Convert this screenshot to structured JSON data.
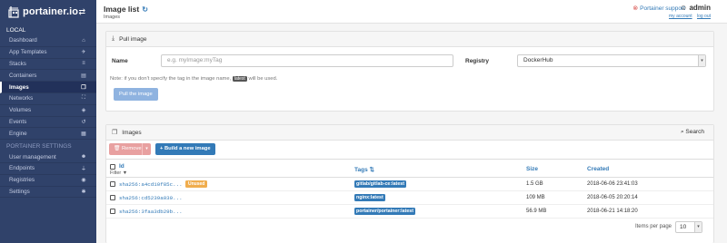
{
  "sidebar": {
    "brand": "portainer.io",
    "toggle_icon": "exchange-icon",
    "section_local": "LOCAL",
    "items": [
      {
        "label": "Dashboard",
        "icon": "dashboard-icon",
        "glyph": "⌂"
      },
      {
        "label": "App Templates",
        "icon": "rocket-icon",
        "glyph": "✈"
      },
      {
        "label": "Stacks",
        "icon": "list-icon",
        "glyph": "≡"
      },
      {
        "label": "Containers",
        "icon": "server-icon",
        "glyph": "▤"
      },
      {
        "label": "Images",
        "icon": "clone-icon",
        "glyph": "❐"
      },
      {
        "label": "Networks",
        "icon": "sitemap-icon",
        "glyph": "⛶"
      },
      {
        "label": "Volumes",
        "icon": "cubes-icon",
        "glyph": "◈"
      },
      {
        "label": "Events",
        "icon": "history-icon",
        "glyph": "↺"
      },
      {
        "label": "Engine",
        "icon": "th-icon",
        "glyph": "▦"
      }
    ],
    "section_settings": "PORTAINER SETTINGS",
    "settings_items": [
      {
        "label": "User management",
        "icon": "users-icon",
        "glyph": "☻"
      },
      {
        "label": "Endpoints",
        "icon": "plug-icon",
        "glyph": "⏚"
      },
      {
        "label": "Registries",
        "icon": "database-icon",
        "glyph": "◉"
      },
      {
        "label": "Settings",
        "icon": "cogs-icon",
        "glyph": "✱"
      }
    ]
  },
  "header": {
    "title": "Image list",
    "breadcrumb": "Images",
    "support": "Portainer support",
    "user": "admin",
    "my_account": "my account",
    "log_out": "log out"
  },
  "pull": {
    "title": "Pull image",
    "name_label": "Name",
    "name_placeholder": "e.g. myImage:myTag",
    "registry_label": "Registry",
    "registry_value": "DockerHub",
    "note_before": "Note: if you don't specify the tag in the image name,",
    "note_tag": "latest",
    "note_after": "will be used.",
    "button": "Pull the image"
  },
  "images": {
    "title": "Images",
    "search": "Search",
    "remove": "Remove",
    "build": "+ Build a new image",
    "columns": {
      "id": "Id",
      "filter": "Filter",
      "tags": "Tags",
      "size": "Size",
      "created": "Created"
    },
    "rows": [
      {
        "id": "sha256:a4cd10f85c...",
        "unused": "Unused",
        "tag": "gitlab/gitlab-ce:latest",
        "size": "1.5 GB",
        "created": "2018-06-06 23:41:03"
      },
      {
        "id": "sha256:cd5239a030...",
        "unused": "",
        "tag": "nginx:latest",
        "size": "109 MB",
        "created": "2018-06-05 20:20:14"
      },
      {
        "id": "sha256:3faa3db29b...",
        "unused": "",
        "tag": "portainer/portainer:latest",
        "size": "56.9 MB",
        "created": "2018-06-21 14:18:20"
      }
    ],
    "items_per_page_label": "Items per page",
    "items_per_page": "10"
  },
  "colors": {
    "sidebar_bg": "#30426a",
    "accent": "#337ab7",
    "unused_badge": "#f0ad4e",
    "remove_button": "#e8a0a0"
  }
}
